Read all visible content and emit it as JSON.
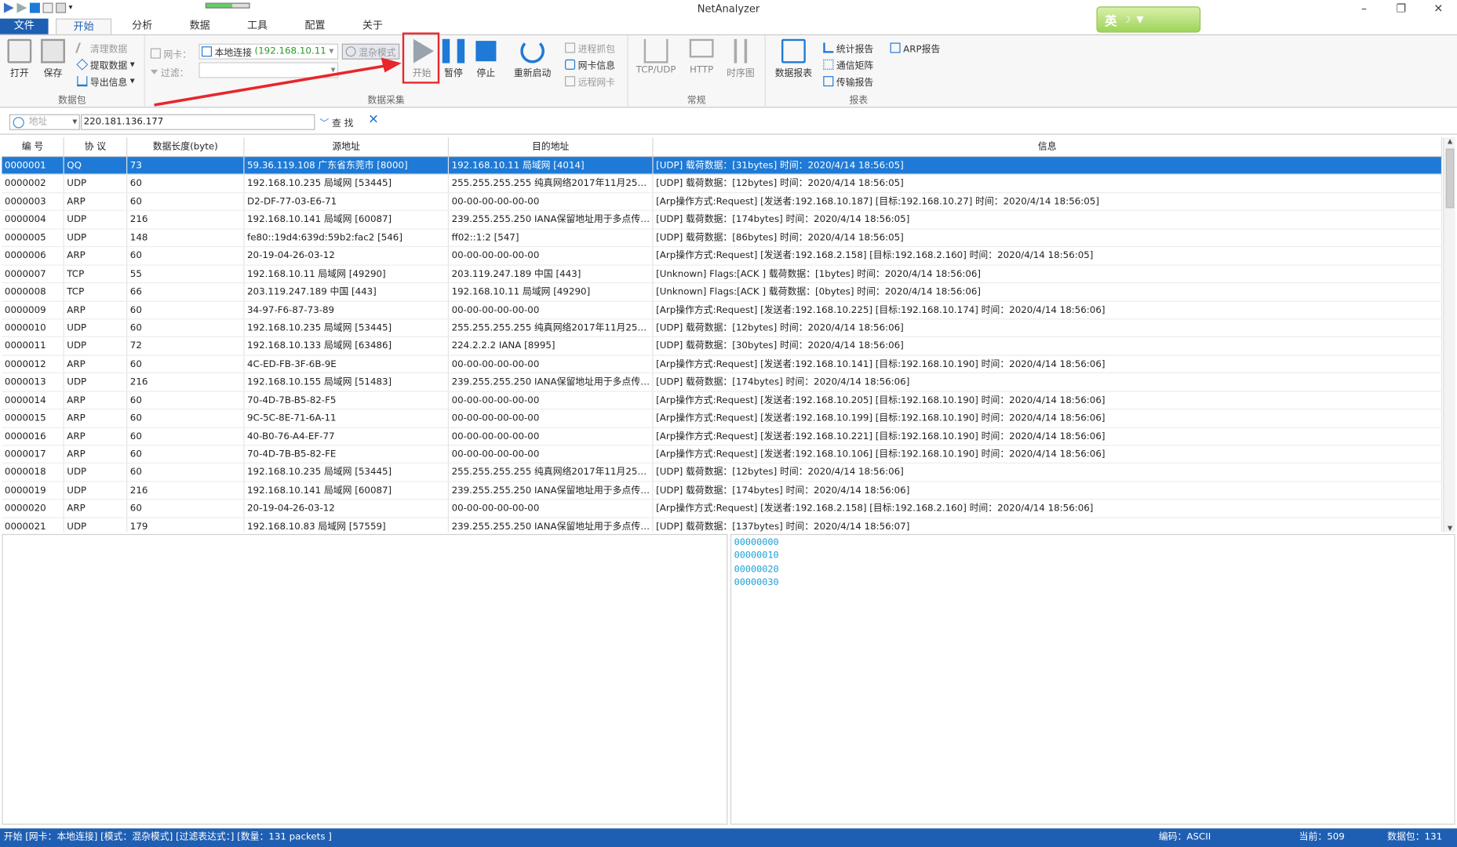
{
  "app": {
    "title": "NetAnalyzer"
  },
  "window_controls": {
    "minimize": "–",
    "maximize": "❐",
    "close": "✕"
  },
  "ime": {
    "label": "英"
  },
  "tabs": [
    "文件",
    "开始",
    "分析",
    "数据",
    "工具",
    "配置",
    "关于"
  ],
  "ribbon": {
    "packet": {
      "open": "打开",
      "save": "保存",
      "clear": "清理数据",
      "extract": "提取数据",
      "export": "导出信息",
      "group": "数据包"
    },
    "capture": {
      "nic_label": "网卡：",
      "nic_value": "本地连接",
      "nic_ip": "(192.168.10.11",
      "promisc": "混杂模式",
      "filter_label": "过滤：",
      "start": "开始",
      "pause": "暂停",
      "stop": "停止",
      "restart": "重新启动",
      "proc_capture": "进程抓包",
      "nic_info": "网卡信息",
      "remote_nic": "远程网卡",
      "group": "数据采集"
    },
    "common": {
      "tcpudp": "TCP/UDP",
      "http": "HTTP",
      "timing": "时序图",
      "group": "常规"
    },
    "report": {
      "data_report": "数据报表",
      "stat_report": "统计报告",
      "comm_matrix": "通信矩阵",
      "transfer_report": "传输报告",
      "arp_report": "ARP报告",
      "group": "报表"
    }
  },
  "filter": {
    "addr_placeholder": "地址",
    "addr_value": "220.181.136.177",
    "find": "查 找"
  },
  "table": {
    "headers": [
      "编 号",
      "协 议",
      "数据长度(byte)",
      "源地址",
      "目的地址",
      "信息"
    ],
    "rows": [
      [
        "0000001",
        "QQ",
        "73",
        "59.36.119.108 广东省东莞市 [8000]",
        "192.168.10.11 局域网 [4014]",
        "[UDP] 载荷数据：[31bytes] 时间：2020/4/14 18:56:05]"
      ],
      [
        "0000002",
        "UDP",
        "60",
        "192.168.10.235 局域网 [53445]",
        "255.255.255.255 纯真网络2017年11月25日I...",
        "[UDP] 载荷数据：[12bytes] 时间：2020/4/14 18:56:05]"
      ],
      [
        "0000003",
        "ARP",
        "60",
        "D2-DF-77-03-E6-71",
        "00-00-00-00-00-00",
        "[Arp操作方式:Request] [发送者:192.168.10.187] [目标:192.168.10.27] 时间：2020/4/14 18:56:05]"
      ],
      [
        "0000004",
        "UDP",
        "216",
        "192.168.10.141 局域网 [60087]",
        "239.255.255.250 IANA保留地址用于多点传送...",
        "[UDP] 载荷数据：[174bytes] 时间：2020/4/14 18:56:05]"
      ],
      [
        "0000005",
        "UDP",
        "148",
        "fe80::19d4:639d:59b2:fac2 [546]",
        "ff02::1:2 [547]",
        "[UDP] 载荷数据：[86bytes] 时间：2020/4/14 18:56:05]"
      ],
      [
        "0000006",
        "ARP",
        "60",
        "20-19-04-26-03-12",
        "00-00-00-00-00-00",
        "[Arp操作方式:Request] [发送者:192.168.2.158] [目标:192.168.2.160] 时间：2020/4/14 18:56:05]"
      ],
      [
        "0000007",
        "TCP",
        "55",
        "192.168.10.11 局域网 [49290]",
        "203.119.247.189 中国 [443]",
        "[Unknown] Flags:[ACK ] 载荷数据：[1bytes] 时间：2020/4/14 18:56:06]"
      ],
      [
        "0000008",
        "TCP",
        "66",
        "203.119.247.189 中国 [443]",
        "192.168.10.11 局域网 [49290]",
        "[Unknown] Flags:[ACK ] 载荷数据：[0bytes] 时间：2020/4/14 18:56:06]"
      ],
      [
        "0000009",
        "ARP",
        "60",
        "34-97-F6-87-73-89",
        "00-00-00-00-00-00",
        "[Arp操作方式:Request] [发送者:192.168.10.225] [目标:192.168.10.174] 时间：2020/4/14 18:56:06]"
      ],
      [
        "0000010",
        "UDP",
        "60",
        "192.168.10.235 局域网 [53445]",
        "255.255.255.255 纯真网络2017年11月25日I...",
        "[UDP] 载荷数据：[12bytes] 时间：2020/4/14 18:56:06]"
      ],
      [
        "0000011",
        "UDP",
        "72",
        "192.168.10.133 局域网 [63486]",
        "224.2.2.2 IANA [8995]",
        "[UDP] 载荷数据：[30bytes] 时间：2020/4/14 18:56:06]"
      ],
      [
        "0000012",
        "ARP",
        "60",
        "4C-ED-FB-3F-6B-9E",
        "00-00-00-00-00-00",
        "[Arp操作方式:Request] [发送者:192.168.10.141] [目标:192.168.10.190] 时间：2020/4/14 18:56:06]"
      ],
      [
        "0000013",
        "UDP",
        "216",
        "192.168.10.155 局域网 [51483]",
        "239.255.255.250 IANA保留地址用于多点传送...",
        "[UDP] 载荷数据：[174bytes] 时间：2020/4/14 18:56:06]"
      ],
      [
        "0000014",
        "ARP",
        "60",
        "70-4D-7B-B5-82-F5",
        "00-00-00-00-00-00",
        "[Arp操作方式:Request] [发送者:192.168.10.205] [目标:192.168.10.190] 时间：2020/4/14 18:56:06]"
      ],
      [
        "0000015",
        "ARP",
        "60",
        "9C-5C-8E-71-6A-11",
        "00-00-00-00-00-00",
        "[Arp操作方式:Request] [发送者:192.168.10.199] [目标:192.168.10.190] 时间：2020/4/14 18:56:06]"
      ],
      [
        "0000016",
        "ARP",
        "60",
        "40-B0-76-A4-EF-77",
        "00-00-00-00-00-00",
        "[Arp操作方式:Request] [发送者:192.168.10.221] [目标:192.168.10.190] 时间：2020/4/14 18:56:06]"
      ],
      [
        "0000017",
        "ARP",
        "60",
        "70-4D-7B-B5-82-FE",
        "00-00-00-00-00-00",
        "[Arp操作方式:Request] [发送者:192.168.10.106] [目标:192.168.10.190] 时间：2020/4/14 18:56:06]"
      ],
      [
        "0000018",
        "UDP",
        "60",
        "192.168.10.235 局域网 [53445]",
        "255.255.255.255 纯真网络2017年11月25日I...",
        "[UDP] 载荷数据：[12bytes] 时间：2020/4/14 18:56:06]"
      ],
      [
        "0000019",
        "UDP",
        "216",
        "192.168.10.141 局域网 [60087]",
        "239.255.255.250 IANA保留地址用于多点传送...",
        "[UDP] 载荷数据：[174bytes] 时间：2020/4/14 18:56:06]"
      ],
      [
        "0000020",
        "ARP",
        "60",
        "20-19-04-26-03-12",
        "00-00-00-00-00-00",
        "[Arp操作方式:Request] [发送者:192.168.2.158] [目标:192.168.2.160] 时间：2020/4/14 18:56:06]"
      ],
      [
        "0000021",
        "UDP",
        "179",
        "192.168.10.83 局域网 [57559]",
        "239.255.255.250 IANA保留地址用于多点传送...",
        "[UDP] 载荷数据：[137bytes] 时间：2020/4/14 18:56:07]"
      ]
    ]
  },
  "hex": {
    "offsets": [
      "00000000",
      "00000010",
      "00000020",
      "00000030"
    ]
  },
  "status": {
    "left": "开始  [网卡：本地连接] [模式：混杂模式]  [过滤表达式：]  [数量：131 packets ]",
    "encoding": "编码：ASCII",
    "current": "当前：509",
    "packets": "数据包：131"
  },
  "colors": {
    "accent": "#1e5fb3",
    "selection": "#1e7ad6",
    "highlight": "#e8262b",
    "hex_text": "#1aa0d8"
  }
}
